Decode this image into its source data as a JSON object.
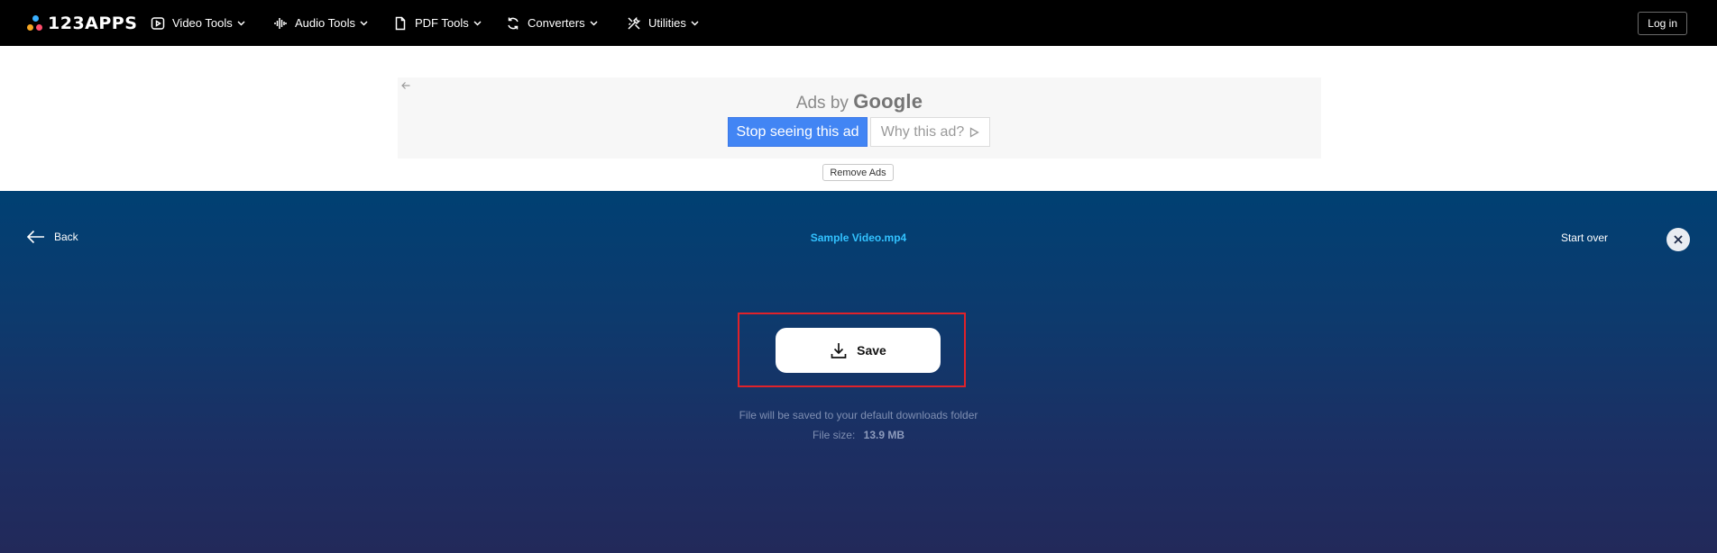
{
  "navbar": {
    "logo_text": "123APPS",
    "items": [
      {
        "label": "Video Tools",
        "icon": "play-icon"
      },
      {
        "label": "Audio Tools",
        "icon": "waveform-icon"
      },
      {
        "label": "PDF Tools",
        "icon": "document-icon"
      },
      {
        "label": "Converters",
        "icon": "refresh-icon"
      },
      {
        "label": "Utilities",
        "icon": "tools-icon"
      }
    ],
    "login_label": "Log in"
  },
  "ad": {
    "ads_by": "Ads by",
    "google": "Google",
    "stop_label": "Stop seeing this ad",
    "why_label": "Why this ad?",
    "remove_ads": "Remove Ads"
  },
  "main": {
    "back_label": "Back",
    "file_name": "Sample Video.mp4",
    "start_over_label": "Start over",
    "save_label": "Save",
    "save_note": "File will be saved to your default downloads folder",
    "file_size_label": "File size:",
    "file_size_value": "13.9 MB"
  },
  "colors": {
    "navbar_bg": "#000000",
    "accent_blue": "#4285f4",
    "file_name": "#32c2ff",
    "highlight": "#e0222a",
    "panel_top": "#004073",
    "panel_bottom": "#22295a"
  }
}
